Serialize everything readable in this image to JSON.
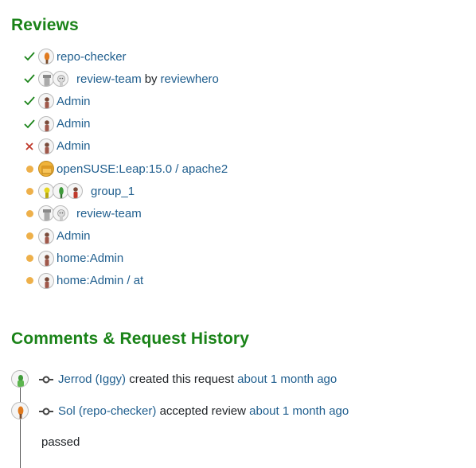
{
  "reviews": {
    "heading": "Reviews",
    "items": [
      {
        "status": "accepted",
        "label": "repo-checker"
      },
      {
        "status": "accepted",
        "label": "review-team",
        "by": "by",
        "reviewer": "reviewhero"
      },
      {
        "status": "accepted",
        "label": "Admin"
      },
      {
        "status": "accepted",
        "label": "Admin"
      },
      {
        "status": "declined",
        "label": "Admin"
      },
      {
        "status": "pending",
        "label": "openSUSE:Leap:15.0 / apache2"
      },
      {
        "status": "pending",
        "label": "group_1"
      },
      {
        "status": "pending",
        "label": "review-team"
      },
      {
        "status": "pending",
        "label": "Admin"
      },
      {
        "status": "pending",
        "label": "home:Admin"
      },
      {
        "status": "pending",
        "label": "home:Admin / at"
      }
    ]
  },
  "history": {
    "heading": "Comments & Request History",
    "events": [
      {
        "user": "Jerrod (Iggy)",
        "action": "created this request",
        "time": "about 1 month ago"
      },
      {
        "user": "Sol (repo-checker)",
        "action": "accepted review",
        "time": "about 1 month ago",
        "comment": "passed"
      }
    ]
  },
  "colors": {
    "heading": "#1a8318",
    "link": "#1f5e8e",
    "accepted": "#1a8318",
    "declined": "#c0392b",
    "pending": "#eeb04a"
  }
}
